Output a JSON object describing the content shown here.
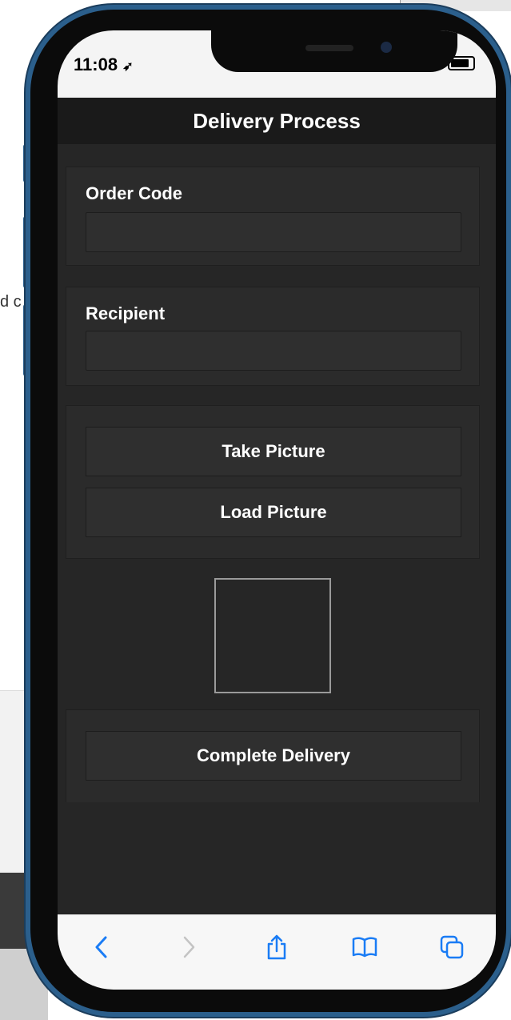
{
  "background": {
    "partial_text": "d c"
  },
  "status_bar": {
    "time": "11:08",
    "location_arrow": "➶"
  },
  "app": {
    "title": "Delivery Process"
  },
  "form": {
    "order_code_label": "Order Code",
    "order_code_value": "",
    "recipient_label": "Recipient",
    "recipient_value": "",
    "take_picture_label": "Take Picture",
    "load_picture_label": "Load Picture",
    "complete_delivery_label": "Complete Delivery"
  },
  "toolbar": {
    "icons": [
      "back-icon",
      "forward-icon",
      "share-icon",
      "bookmarks-icon",
      "tabs-icon"
    ],
    "accent": "#1a7cf5",
    "disabled": "#c4c4c4"
  },
  "colors": {
    "frame": "#2b5f8c",
    "app_background": "#262626",
    "header_background": "#1a1a1a"
  }
}
